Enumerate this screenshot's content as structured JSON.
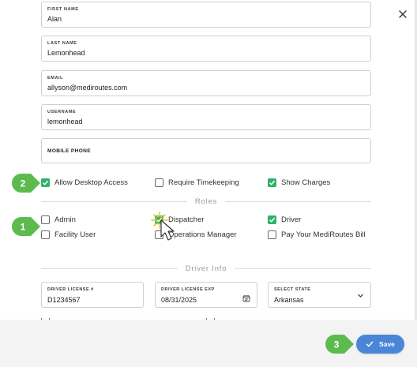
{
  "form": {
    "first_name": {
      "label": "FIRST NAME",
      "value": "Alan"
    },
    "last_name": {
      "label": "LAST NAME",
      "value": "Lemonhead"
    },
    "email": {
      "label": "EMAIL",
      "value": "allyson@mediroutes.com"
    },
    "username": {
      "label": "USERNAME",
      "value": "lemonhead"
    },
    "mobile_phone": {
      "label": "MOBILE PHONE",
      "value": ""
    }
  },
  "access": {
    "allow_desktop": {
      "label": "Allow Desktop Access",
      "checked": true
    },
    "require_timekeeping": {
      "label": "Require Timekeeping",
      "checked": false
    },
    "show_charges": {
      "label": "Show Charges",
      "checked": true
    }
  },
  "roles": {
    "title": "Roles",
    "admin": {
      "label": "Admin",
      "checked": false
    },
    "dispatcher": {
      "label": "Dispatcher",
      "checked": true
    },
    "driver": {
      "label": "Driver",
      "checked": true
    },
    "facility_user": {
      "label": "Facility User",
      "checked": false
    },
    "operations_manager": {
      "label": "Operations Manager",
      "checked": false
    },
    "pay_mediroutes_bill": {
      "label": "Pay Your MediRoutes Bill",
      "checked": false
    }
  },
  "driver_info": {
    "title": "Driver Info",
    "license_num": {
      "label": "DRIVER LICENSE #",
      "value": "D1234567"
    },
    "license_exp": {
      "label": "DRIVER LICENSE EXP",
      "value": "08/31/2025"
    },
    "state": {
      "label": "SELECT STATE",
      "value": "Arkansas"
    }
  },
  "footer": {
    "save_label": "Save"
  },
  "callouts": {
    "c1": "1",
    "c2": "2",
    "c3": "3"
  },
  "colors": {
    "accent": "#4a86d8",
    "check": "#2fb36a",
    "callout": "#5dbb4e"
  }
}
